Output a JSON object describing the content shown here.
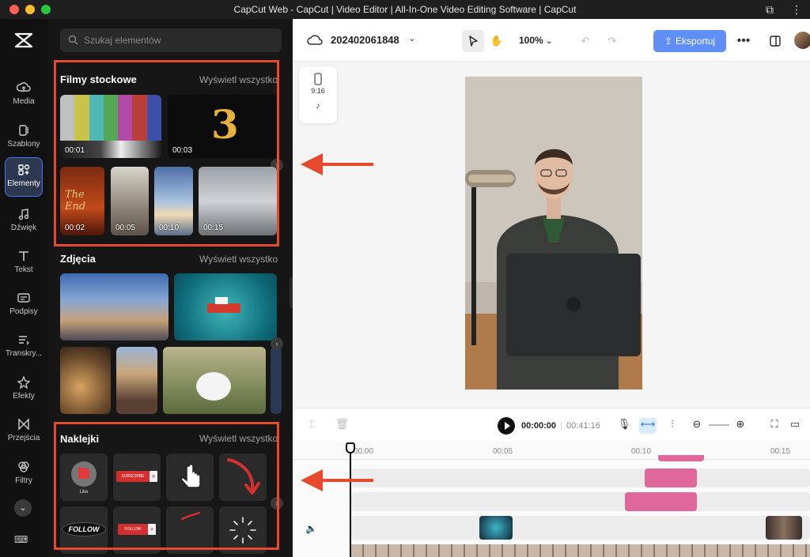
{
  "window": {
    "title": "CapCut Web - CapCut | Video Editor | All-In-One Video Editing Software | CapCut"
  },
  "nav": {
    "items": [
      {
        "label": "Media",
        "icon": "cloud-upload-icon"
      },
      {
        "label": "Szablony",
        "icon": "template-icon"
      },
      {
        "label": "Elementy",
        "icon": "elements-icon",
        "active": true
      },
      {
        "label": "Dźwięk",
        "icon": "music-note-icon"
      },
      {
        "label": "Tekst",
        "icon": "text-icon"
      },
      {
        "label": "Podpisy",
        "icon": "captions-icon"
      },
      {
        "label": "Transkry...",
        "icon": "transcript-icon"
      },
      {
        "label": "Efekty",
        "icon": "effects-icon"
      },
      {
        "label": "Przejścia",
        "icon": "transitions-icon"
      },
      {
        "label": "Filtry",
        "icon": "filters-icon"
      }
    ]
  },
  "panel": {
    "search_placeholder": "Szukaj elementów",
    "stock": {
      "title": "Filmy stockowe",
      "view_all": "Wyświetl wszystko",
      "clips": [
        "00:01",
        "00:03",
        "00:02",
        "00:05",
        "00:10",
        "00:15"
      ]
    },
    "photos": {
      "title": "Zdjęcia",
      "view_all": "Wyświetl wszystko"
    },
    "stickers": {
      "title": "Naklejki",
      "view_all": "Wyświetl wszystko",
      "like_label": "Like",
      "subscribe_label": "SUBSCRIBE",
      "follow_label": "FOLLOW",
      "follow_black_label": "FOLLOW"
    }
  },
  "editor": {
    "project_name": "202402061848",
    "zoom": "100%",
    "export_label": "Eksportuj",
    "ratio": "9:16",
    "time_current": "00:00:00",
    "time_total": "00:41:16",
    "ruler": [
      "00:00",
      "00:05",
      "00:10",
      "00:15"
    ]
  },
  "colors": {
    "accent": "#5f8ef6",
    "highlight": "#e64a2e",
    "clip": "#e0679a"
  }
}
